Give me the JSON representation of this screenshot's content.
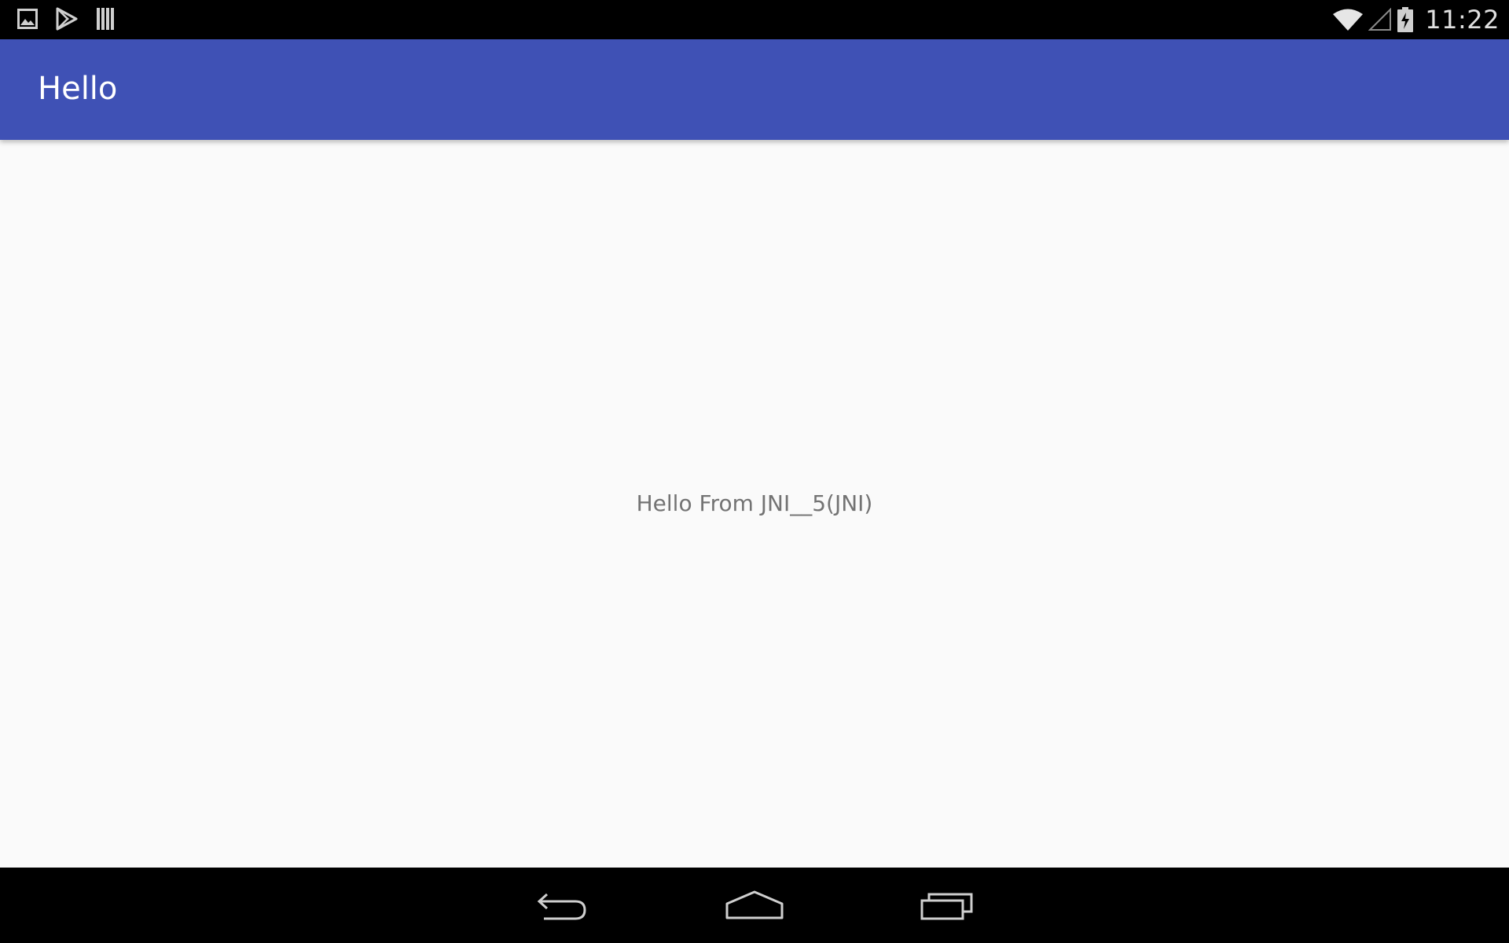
{
  "status_bar": {
    "notification_icons": [
      "gallery-icon",
      "play-store-icon",
      "barcode-icon"
    ],
    "system_icons": [
      "wifi-icon",
      "cell-signal-icon",
      "battery-charging-icon"
    ],
    "time": "11:22"
  },
  "app_bar": {
    "title": "Hello",
    "color": "#3f51b5"
  },
  "content": {
    "message": "Hello From JNI__5(JNI)"
  },
  "nav_bar": {
    "buttons": [
      "back-icon",
      "home-icon",
      "recents-icon"
    ]
  }
}
